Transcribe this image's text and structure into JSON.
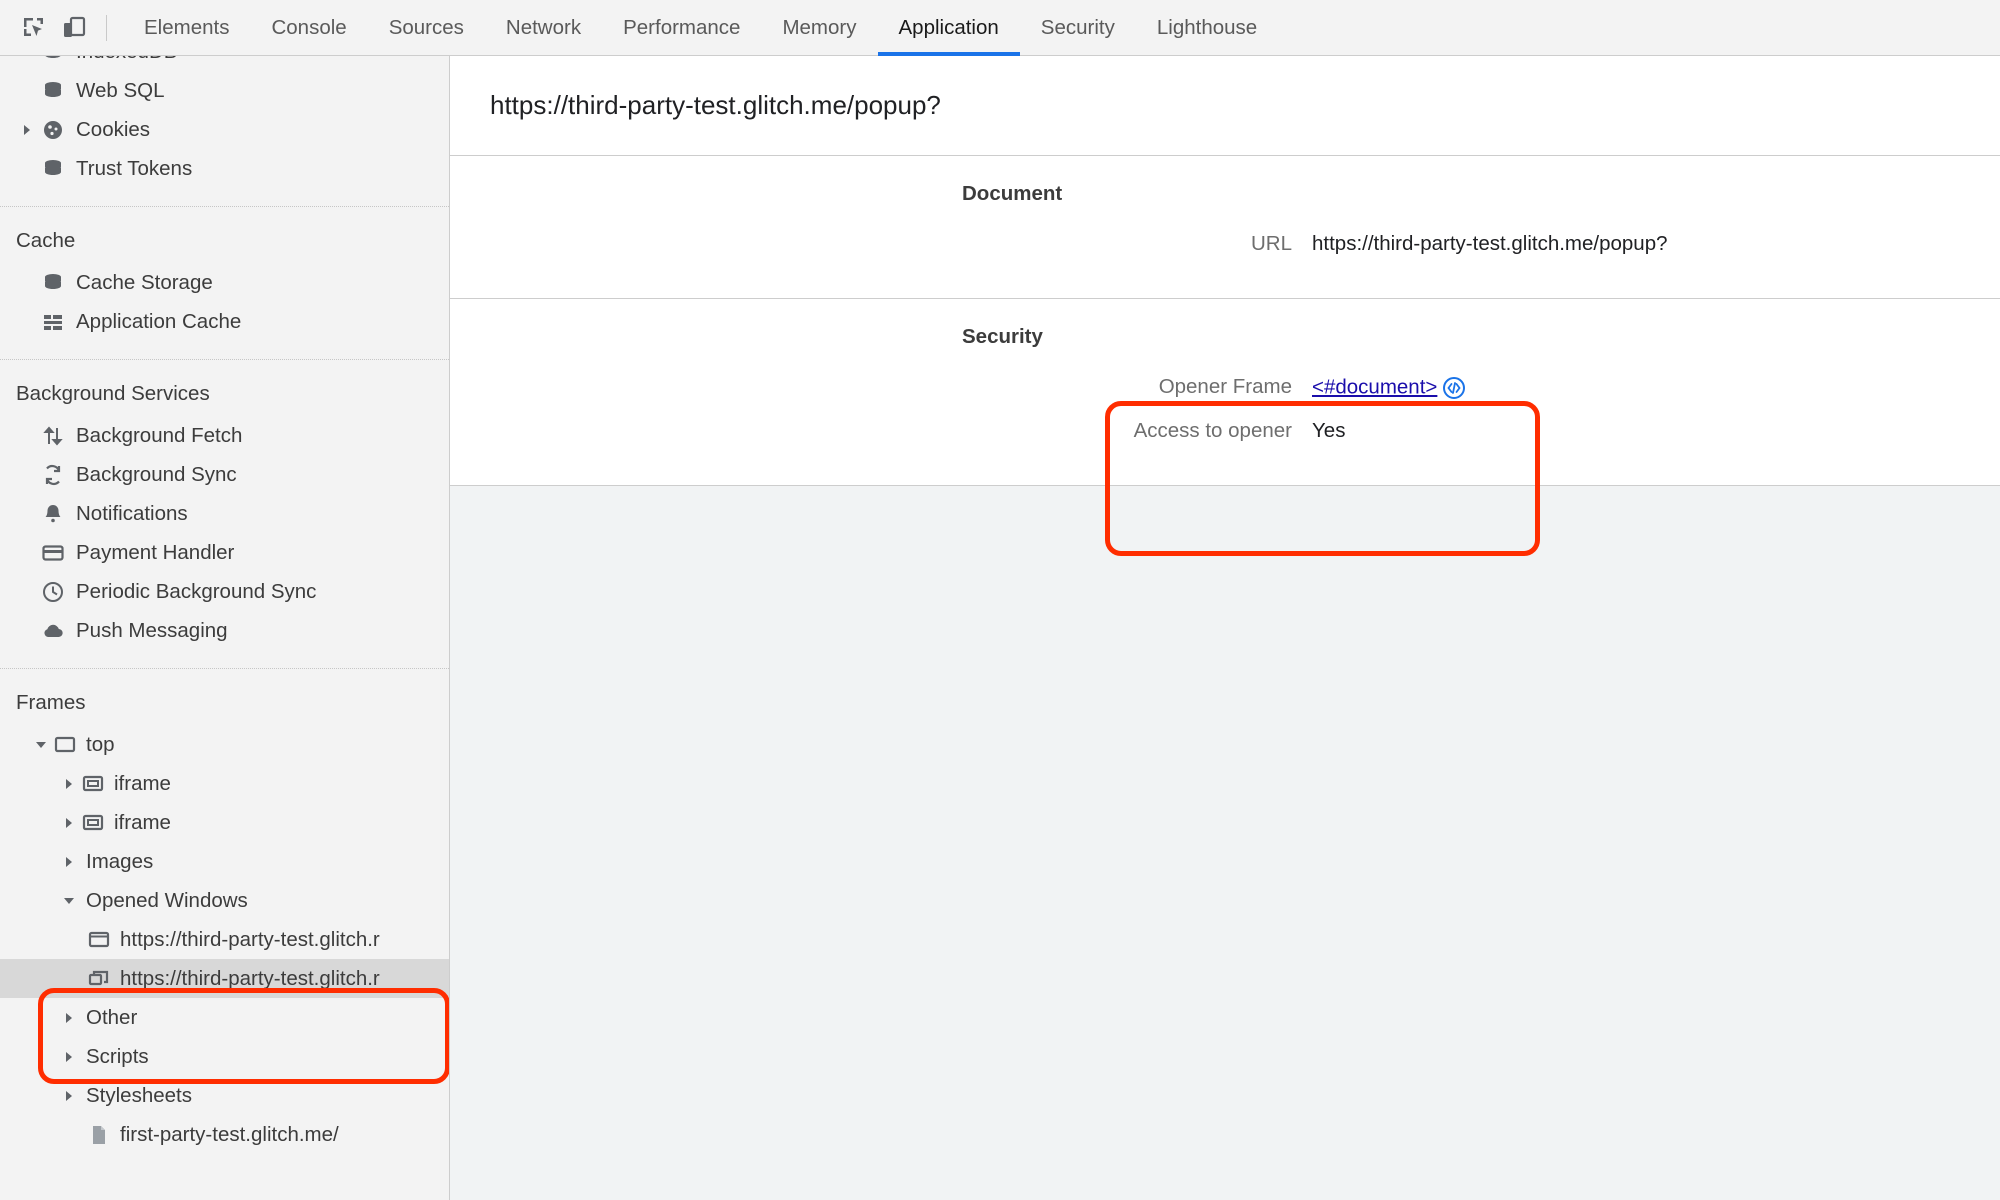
{
  "toolbar": {
    "inspect_icon": "inspect-element-icon",
    "device_icon": "device-toolbar-icon",
    "tabs": [
      {
        "label": "Elements",
        "active": false
      },
      {
        "label": "Console",
        "active": false
      },
      {
        "label": "Sources",
        "active": false
      },
      {
        "label": "Network",
        "active": false
      },
      {
        "label": "Performance",
        "active": false
      },
      {
        "label": "Memory",
        "active": false
      },
      {
        "label": "Application",
        "active": true
      },
      {
        "label": "Security",
        "active": false
      },
      {
        "label": "Lighthouse",
        "active": false
      }
    ]
  },
  "sidebar": {
    "storage_items": [
      {
        "label": "IndexedDB",
        "icon": "database-icon"
      },
      {
        "label": "Web SQL",
        "icon": "database-icon"
      },
      {
        "label": "Cookies",
        "icon": "cookie-icon"
      },
      {
        "label": "Trust Tokens",
        "icon": "database-icon"
      }
    ],
    "cache_title": "Cache",
    "cache_items": [
      {
        "label": "Cache Storage",
        "icon": "database-icon"
      },
      {
        "label": "Application Cache",
        "icon": "grid-icon"
      }
    ],
    "background_title": "Background Services",
    "background_items": [
      {
        "label": "Background Fetch",
        "icon": "arrows-updown-icon"
      },
      {
        "label": "Background Sync",
        "icon": "sync-icon"
      },
      {
        "label": "Notifications",
        "icon": "bell-icon"
      },
      {
        "label": "Payment Handler",
        "icon": "credit-card-icon"
      },
      {
        "label": "Periodic Background Sync",
        "icon": "clock-icon"
      },
      {
        "label": "Push Messaging",
        "icon": "cloud-icon"
      }
    ],
    "frames_title": "Frames",
    "frames": [
      {
        "label": "top",
        "icon": "frame-icon",
        "indent": 1,
        "arrow": "down"
      },
      {
        "label": "iframe",
        "icon": "iframe-icon",
        "indent": 2,
        "arrow": "right"
      },
      {
        "label": "iframe",
        "icon": "iframe-icon",
        "indent": 2,
        "arrow": "right"
      },
      {
        "label": "Images",
        "icon": "none",
        "indent": 2,
        "arrow": "right"
      },
      {
        "label": "Opened Windows",
        "icon": "none",
        "indent": 2,
        "arrow": "down"
      },
      {
        "label": "https://third-party-test.glitch.r",
        "icon": "window-icon",
        "indent": 3,
        "arrow": "none"
      },
      {
        "label": "https://third-party-test.glitch.r",
        "icon": "popup-window-icon",
        "indent": 3,
        "arrow": "none",
        "selected": true
      },
      {
        "label": "Other",
        "icon": "none",
        "indent": 2,
        "arrow": "right"
      },
      {
        "label": "Scripts",
        "icon": "none",
        "indent": 2,
        "arrow": "right"
      },
      {
        "label": "Stylesheets",
        "icon": "none",
        "indent": 2,
        "arrow": "right"
      },
      {
        "label": "first-party-test.glitch.me/",
        "icon": "document-icon",
        "indent": 3,
        "arrow": "none"
      }
    ]
  },
  "main": {
    "page_title": "https://third-party-test.glitch.me/popup?",
    "document_section": {
      "title": "Document",
      "url_label": "URL",
      "url_value": "https://third-party-test.glitch.me/popup?"
    },
    "security_section": {
      "title": "Security",
      "opener_frame_label": "Opener Frame",
      "opener_frame_value": "<#document>",
      "reveal_icon": "code-reveal-icon",
      "access_label": "Access to opener",
      "access_value": "Yes"
    }
  },
  "colors": {
    "accent": "#1a73e8",
    "annotation": "#ff2d00",
    "link": "#1a0dab",
    "sidebar_bg": "#f3f3f3",
    "selected_row": "#d8d8d8"
  }
}
